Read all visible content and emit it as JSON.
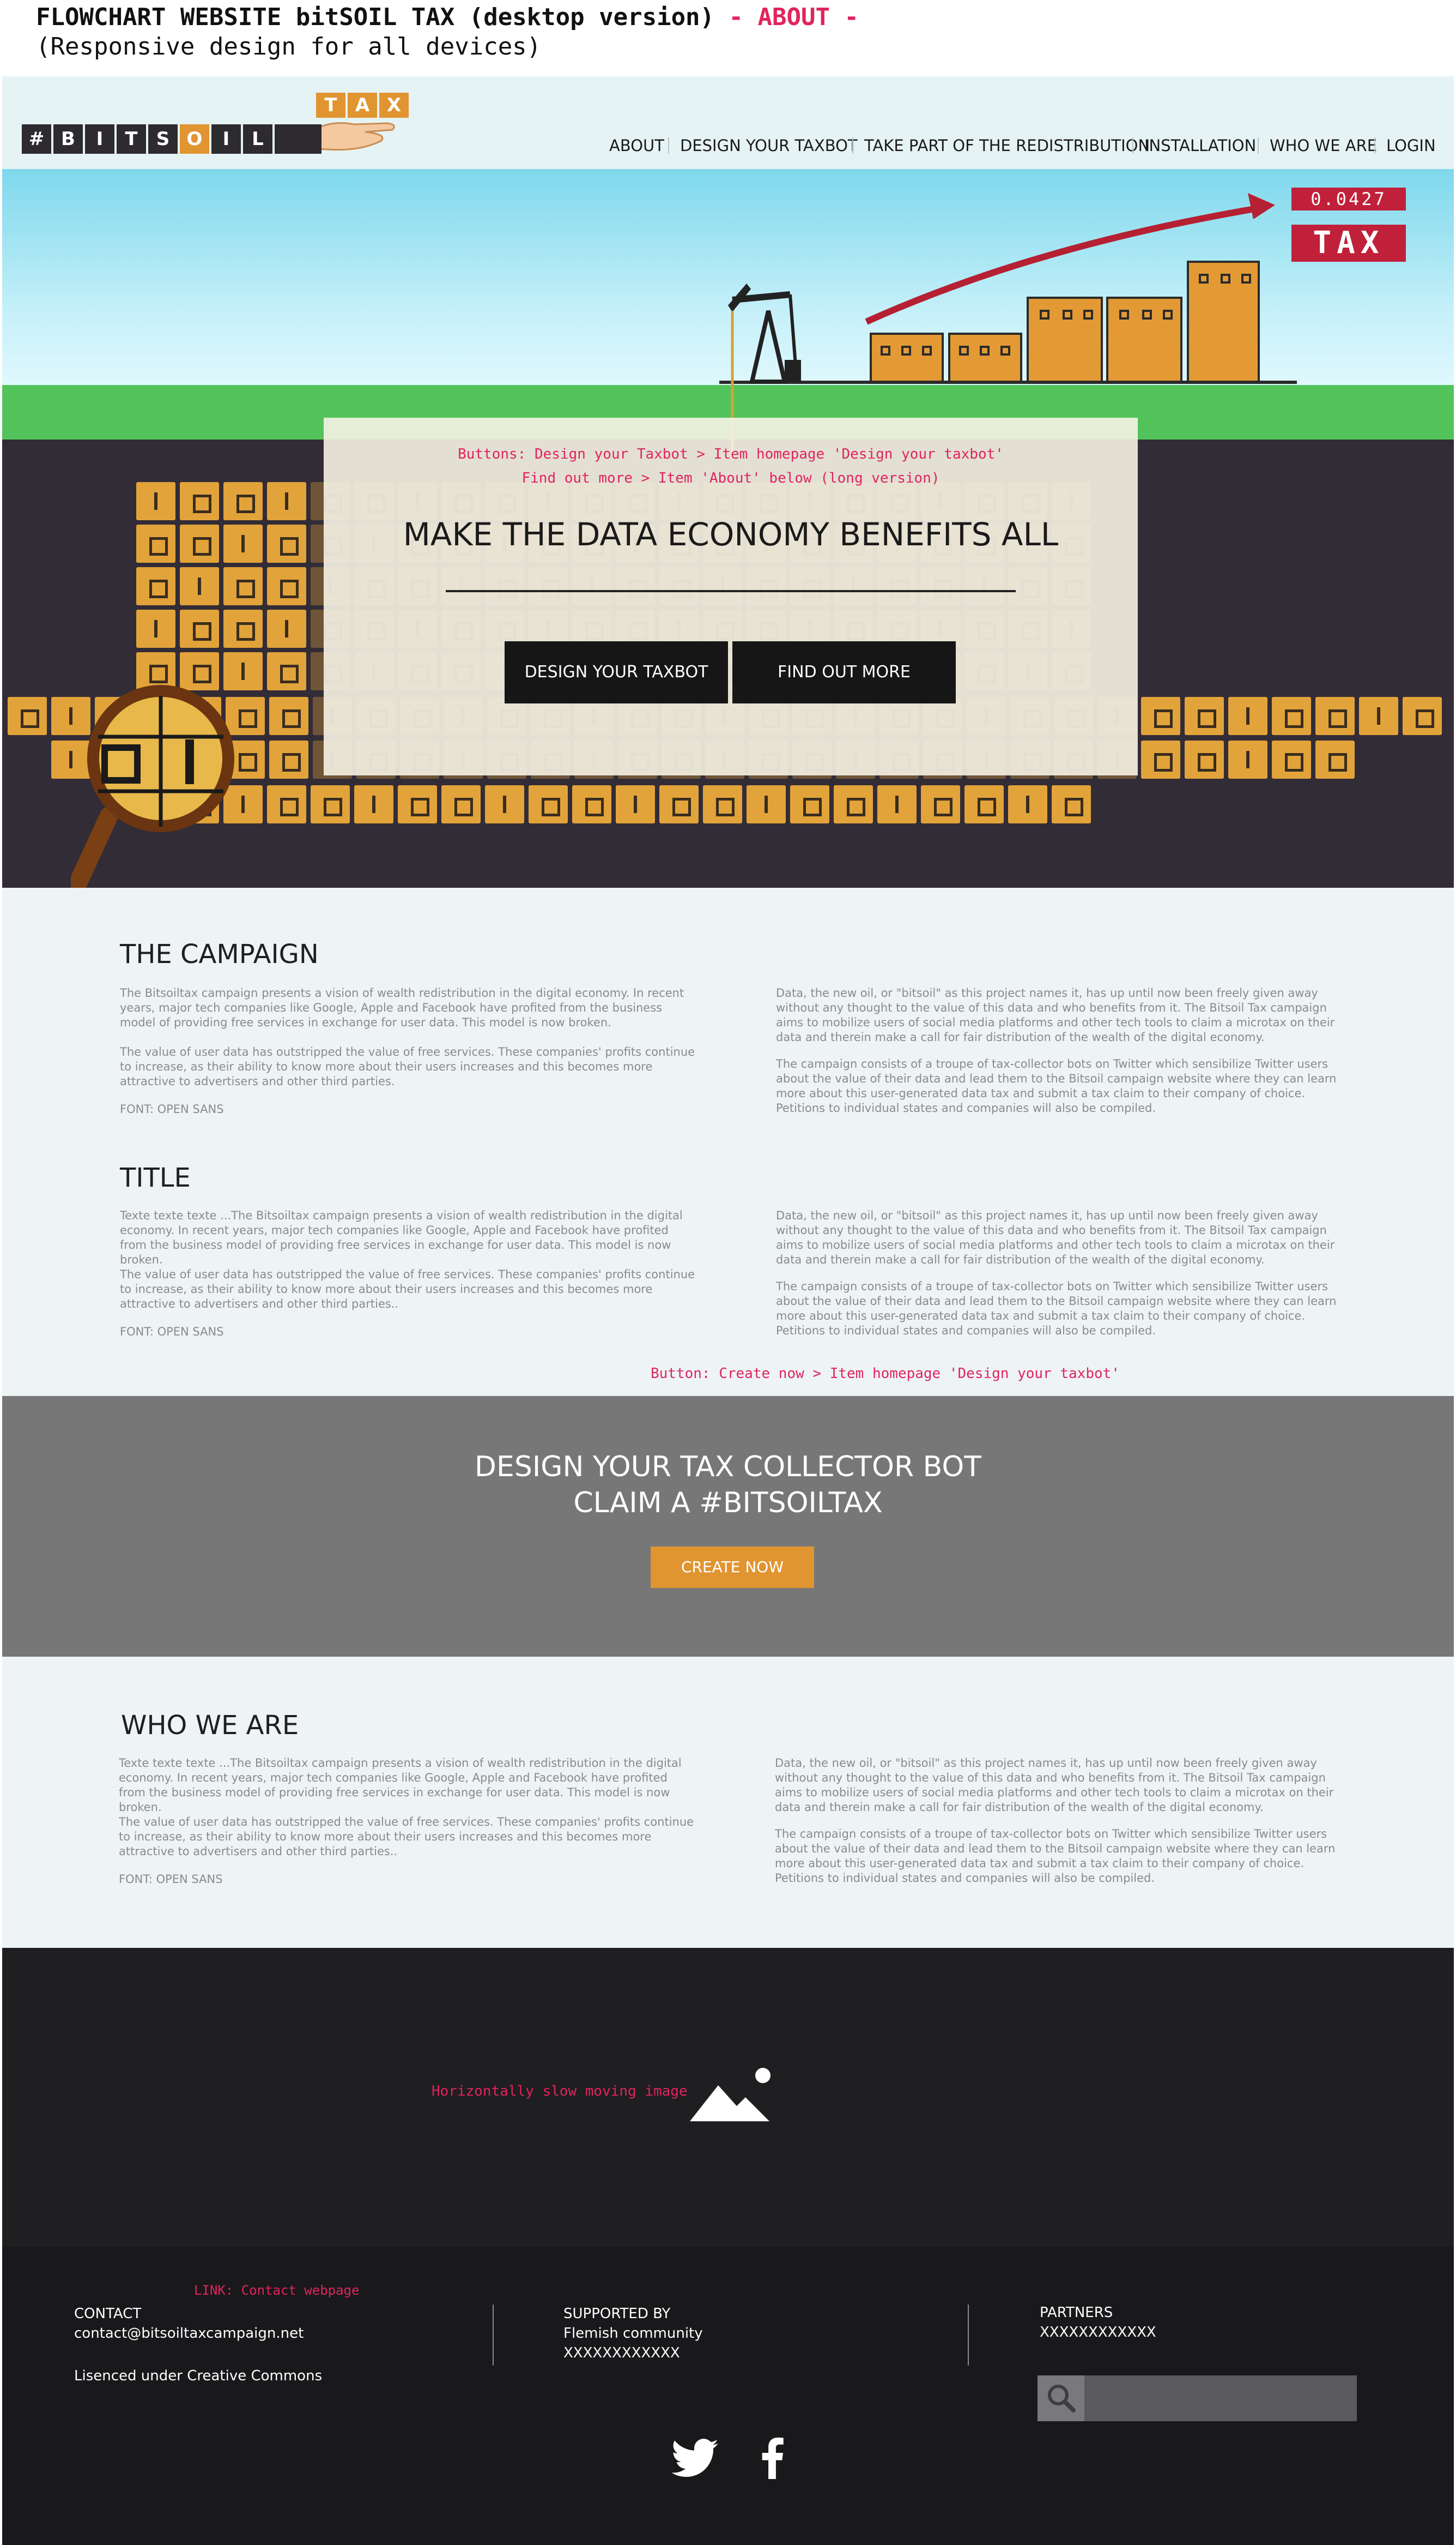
{
  "doc": {
    "title_main": "FLOWCHART WEBSITE bitSOIL TAX (desktop version)",
    "title_accent": " - ABOUT -",
    "subtitle": "(Responsive design for all devices)"
  },
  "logo": {
    "hash": "#",
    "letters": [
      "B",
      "I",
      "T",
      "S",
      "O",
      "I",
      "L"
    ],
    "tax": [
      "T",
      "A",
      "X"
    ]
  },
  "nav": [
    "ABOUT",
    "DESIGN YOUR TAXBOT",
    "TAKE PART OF THE REDISTRIBUTION",
    "INSTALLATION",
    "WHO WE ARE",
    "LOGIN"
  ],
  "hero": {
    "ticker": "0.0427",
    "tax_badge": "TAX",
    "note_line1": "Buttons: Design your Taxbot > Item homepage 'Design your taxbot'",
    "note_line2": "Find out more > Item 'About' below (long version)",
    "heading": "MAKE THE DATA ECONOMY BENEFITS  ALL",
    "btn_design": "DESIGN YOUR TAXBOT",
    "btn_more": "FIND OUT MORE"
  },
  "campaign": {
    "title": "THE CAMPAIGN",
    "left_p1": "The Bitsoiltax campaign presents a vision of wealth redistribution in the digital economy. In recent years, major tech companies like Google, Apple and Facebook have profited from the business model of providing free services in exchange for user data. This model is now broken.",
    "left_p2": "The value of user data has outstripped the value of free services. These companies' profits continue to increase, as their ability to know more about their users increases and this becomes more attractive to advertisers and other third parties.",
    "font_note": "FONT: OPEN SANS",
    "right_p1": "Data, the new oil, or \"bitsoil\" as this project names it, has up until now been freely given away without any thought to the value of this data and who benefits from it. The Bitsoil Tax campaign aims to mobilize users of social media platforms and other tech tools to claim a microtax on their data and therein make a call for fair distribution of the wealth of the digital economy.",
    "right_p2": "The campaign consists of a troupe of tax-collector bots on Twitter which sensibilize Twitter users about the value of their data and lead them to the Bitsoil campaign website where they can learn more about this user-generated data tax and submit a tax claim to their company of choice. Petitions to individual states and companies will also be compiled."
  },
  "title_section": {
    "title": "TITLE",
    "left_p1": "Texte texte texte ...The Bitsoiltax campaign presents a vision of wealth redistribution in the digital economy. In recent years, major tech companies like Google, Apple and Facebook have profited from the business model of providing free services in exchange for user data. This model is now broken.",
    "left_p2": "The value of user data has outstripped the value of free services. These companies' profits continue to increase, as their ability to know more about their users increases and this becomes more attractive to advertisers and other third parties..",
    "font_note": "FONT: OPEN SANS",
    "right_p1": "Data, the new oil, or \"bitsoil\" as this project names it, has up until now been freely given away without any thought to the value of this data and who benefits from it. The Bitsoil Tax campaign aims to mobilize users of social media platforms and other tech tools to claim a microtax on their data and therein make a call for fair distribution of the wealth of the digital economy.",
    "right_p2": "The campaign consists of a troupe of tax-collector bots on Twitter which sensibilize Twitter users about the value of their data and lead them to the Bitsoil campaign website where they can learn more about this user-generated data tax and submit a tax claim to their company of choice. Petitions to individual states and companies will also be compiled.",
    "button_note": "Button: Create now > Item homepage 'Design your taxbot'"
  },
  "cta": {
    "line1": "DESIGN YOUR TAX COLLECTOR BOT",
    "line2": "CLAIM A #BITSOILTAX",
    "button": "CREATE NOW"
  },
  "who": {
    "title": "WHO WE ARE",
    "left_p1": "Texte texte texte ...The Bitsoiltax campaign presents a vision of wealth redistribution in the digital economy. In recent years, major tech companies like Google, Apple and Facebook have profited from the business model of providing free services in exchange for user data. This model is now broken.",
    "left_p2": "The value of user data has outstripped the value of free services. These companies' profits continue to increase, as their ability to know more about their users increases and this becomes more attractive to advertisers and other third parties..",
    "font_note": "FONT: OPEN SANS",
    "right_p1": "Data, the new oil, or \"bitsoil\" as this project names it, has up until now been freely given away without any thought to the value of this data and who benefits from it. The Bitsoil Tax campaign aims to mobilize users of social media platforms and other tech tools to claim a microtax on their data and therein make a call for fair distribution of the wealth of the digital economy.",
    "right_p2": "The campaign consists of a troupe of tax-collector bots on Twitter which sensibilize Twitter users about the value of their data and lead them to the Bitsoil campaign website where they can learn more about this user-generated data tax and submit a tax claim to their company of choice. Petitions to individual states and companies will also be compiled."
  },
  "image_band": {
    "note": "Horizontally slow moving image",
    "icon": "image-placeholder-icon"
  },
  "footer": {
    "link_note": "LINK: Contact webpage",
    "contact_label": "CONTACT",
    "contact_email": "contact@bitsoiltaxcampaign.net",
    "license": "Lisenced under Creative Commons",
    "supported_label": "SUPPORTED BY",
    "supported_name": "Flemish community",
    "supported_x": "XXXXXXXXXXXX",
    "partners_label": "PARTNERS",
    "partners_x": "XXXXXXXXXXXX",
    "icons": [
      "search-icon",
      "twitter-icon",
      "facebook-icon"
    ]
  },
  "colors": {
    "accent_red": "#e0245e",
    "orange": "#e09531",
    "dark": "#322c36",
    "sky": "#7fd8ec",
    "grass": "#52c35a"
  }
}
